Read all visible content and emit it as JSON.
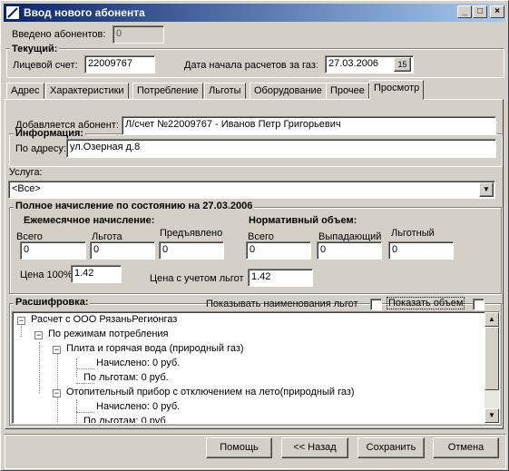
{
  "window": {
    "title": "Ввод нового абонента",
    "minimize": "_",
    "maximize": "□",
    "close": "×"
  },
  "header": {
    "entered_label": "Введено абонентов:",
    "entered_value": "0",
    "current_group": "Текущий:",
    "account_label": "Лицевой счет:",
    "account_value": "22009767",
    "date_label": "Дата начала расчетов за газ:",
    "date_value": "27.03.2006",
    "calendar_icon": "calendar-icon",
    "calendar_text": "15"
  },
  "tabs": [
    "Адрес",
    "Характеристики",
    "Потребление",
    "Льготы",
    "Оборудование",
    "Прочее",
    "Просмотр"
  ],
  "active_tab": "Просмотр",
  "info": {
    "title": "Информация:",
    "subscriber_label": "Добавляется абонент:",
    "subscriber_value": "Л/счет №22009767  - Иванов Петр Григорьевич",
    "address_label": "По адресу:",
    "address_value": "ул.Озерная  д.8"
  },
  "service": {
    "label": "Услуга:",
    "value": "<Все>",
    "arrow_icon": "chevron-down-icon"
  },
  "accrual": {
    "title": "Полное начисление по состоянию на 27.03.2006",
    "monthly_title": "Ежемесячное начисление:",
    "normative_title": "Нормативный объем:",
    "total_label": "Всего",
    "total_value": "0",
    "benefit_label": "Льгота",
    "benefit_value": "0",
    "presented_label": "Предъявлено",
    "presented_value": "0",
    "norm_total_label": "Всего",
    "norm_total_value": "0",
    "dropping_label": "Выпадающий",
    "dropping_value": "0",
    "preferential_label": "Льготный",
    "preferential_value": "0",
    "price100_label": "Цена 100%",
    "price100_value": "1.42",
    "price_benefit_label": "Цена с учетом льгот",
    "price_benefit_value": "1.42"
  },
  "decode": {
    "title": "Расшифровка:",
    "show_benefit_names_label": "Показывать наименования льгот",
    "show_volume_label": "Показать объем",
    "tree": [
      "Расчет с ООО РязаньРегионгаз",
      "По режимам потребления",
      "Плита и горячая вода (природный газ)",
      "Начислено: 0 руб.",
      "По льготам: 0 руб.",
      "Отопительный прибор с отключением на лето(природный газ)",
      "Начислено: 0 руб.",
      "По льготам: 0 руб."
    ],
    "minus_sign": "−"
  },
  "buttons": {
    "help": "Помощь",
    "back": "<< Назад",
    "save": "Сохранить",
    "cancel": "Отмена"
  }
}
